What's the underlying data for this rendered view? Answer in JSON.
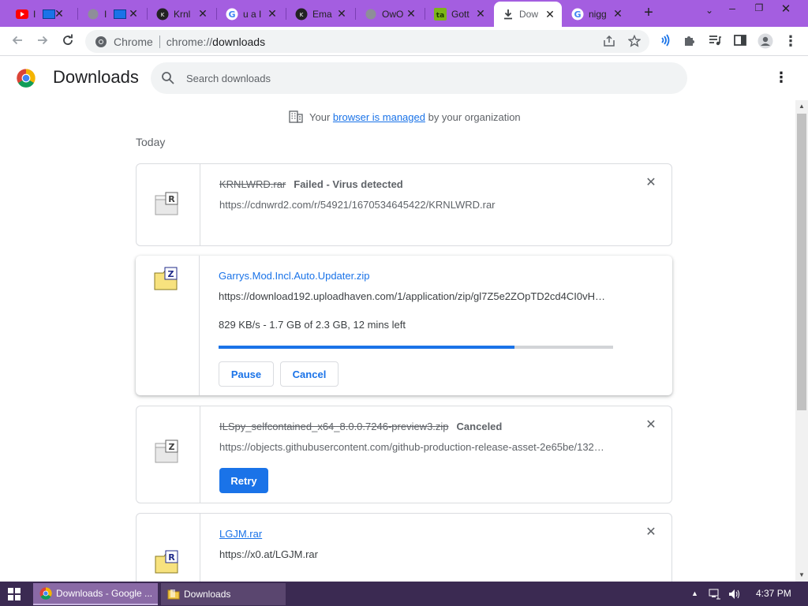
{
  "tabs": [
    {
      "title": "I",
      "icon": "youtube-icon"
    },
    {
      "title": "I",
      "icon": "window-icon"
    },
    {
      "title": "Krnl",
      "icon": "krnl-icon"
    },
    {
      "title": "u a I",
      "icon": "google-icon"
    },
    {
      "title": "Ema",
      "icon": "krnl-icon"
    },
    {
      "title": "OwO",
      "icon": "globe-icon"
    },
    {
      "title": "Gott",
      "icon": "ta-icon"
    },
    {
      "title": "Dow",
      "icon": "download-icon",
      "active": true
    },
    {
      "title": "nigg",
      "icon": "google-icon"
    }
  ],
  "toolbar": {
    "site_label": "Chrome",
    "url_scheme": "chrome://",
    "url_path": "downloads"
  },
  "header": {
    "title": "Downloads",
    "search_placeholder": "Search downloads"
  },
  "managed": {
    "prefix": "Your",
    "link": "browser is managed",
    "suffix": "by your organization"
  },
  "section_label": "Today",
  "downloads": [
    {
      "filename": "KRNLWRD.rar",
      "status": "Failed - Virus detected",
      "url": "https://cdnwrd2.com/r/54921/1670534645422/KRNLWRD.rar",
      "icon_letter": "R"
    },
    {
      "filename": "Garrys.Mod.Incl.Auto.Updater.zip",
      "url": "https://download192.uploadhaven.com/1/application/zip/gl7Z5e2ZOpTD2cd4CI0vH…",
      "progress_text": "829 KB/s - 1.7 GB of 2.3 GB, 12 mins left",
      "progress": 0.75,
      "pause_label": "Pause",
      "cancel_label": "Cancel",
      "icon_letter": "Z"
    },
    {
      "filename": "ILSpy_selfcontained_x64_8.0.0.7246-preview3.zip",
      "status": "Canceled",
      "url": "https://objects.githubusercontent.com/github-production-release-asset-2e65be/132…",
      "retry_label": "Retry",
      "icon_letter": "Z"
    },
    {
      "filename": "LGJM.rar",
      "url": "https://x0.at/LGJM.rar",
      "icon_letter": "R"
    }
  ],
  "taskbar": {
    "tasks": [
      {
        "label": "Downloads - Google ...",
        "icon": "chrome-icon"
      },
      {
        "label": "Downloads",
        "icon": "folder-icon"
      }
    ],
    "clock": "4:37 PM"
  },
  "colors": {
    "tabstrip": "#a45ee0",
    "link": "#1a73e8",
    "taskbar": "#3b2a52"
  }
}
